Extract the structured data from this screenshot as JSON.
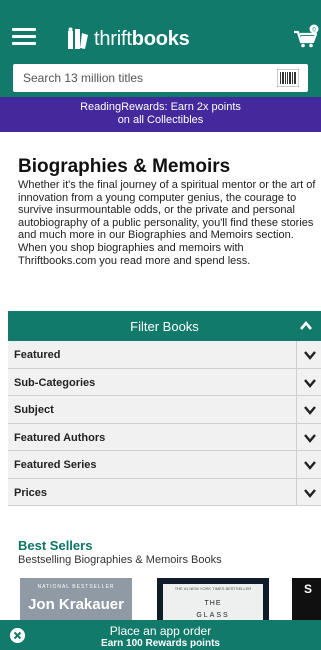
{
  "header": {
    "logo_light": "thrift",
    "logo_bold": "books",
    "cart_count": "0"
  },
  "search": {
    "placeholder": "Search 13 million titles"
  },
  "promo": {
    "line1": "ReadingRewards: Earn 2x points",
    "line2": "on all Collectibles"
  },
  "main": {
    "title": "Biographies & Memoirs",
    "description": "Whether it's the final journey of a spiritual mentor or the art of innovation from a young computer genius, the courage to survive insurmountable odds, or the private and personal autobiography of a public personality, you'll find these stories and much more in our Biographies and Memoirs section. When you shop biographies and memoirs with Thriftbooks.com you read more and spend less."
  },
  "filters": {
    "title": "Filter Books",
    "items": [
      {
        "label": "Featured"
      },
      {
        "label": "Sub-Categories"
      },
      {
        "label": "Subject"
      },
      {
        "label": "Featured Authors"
      },
      {
        "label": "Featured Series"
      },
      {
        "label": "Prices"
      }
    ]
  },
  "best_sellers": {
    "title": "Best Sellers",
    "subtitle": "Bestselling Biographies & Memoirs Books",
    "books": [
      {
        "note": "NATIONAL BESTSELLER",
        "author": "Jon Krakauer"
      },
      {
        "note": "THE #1 NEW YORK TIMES BESTSELLER",
        "title_line1": "THE",
        "title_line2": "GLASS"
      },
      {
        "letter": "S"
      }
    ]
  },
  "app_banner": {
    "title": "Place an app order",
    "subtitle": "Earn 100 Rewards points"
  },
  "colors": {
    "brand_green": "#127a6b",
    "promo_purple": "#43299b",
    "section_green_text": "#0d7566"
  },
  "icons": {
    "menu": "hamburger-menu-icon",
    "logo": "thriftbooks-logo-icon",
    "cart": "cart-icon",
    "barcode": "barcode-scanner-icon",
    "collapse": "chevron-up-icon",
    "expand": "chevron-down-icon",
    "close": "close-icon"
  }
}
